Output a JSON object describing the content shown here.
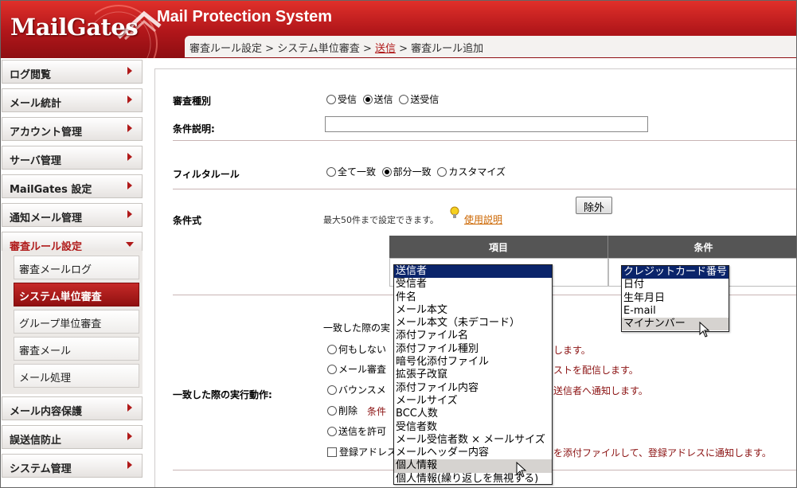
{
  "app": {
    "logo": "MailGates",
    "title": "Mail Protection System"
  },
  "breadcrumb": [
    "審査ルール設定",
    "システム単位審査",
    "送信",
    "審査ルール追加"
  ],
  "sidebar": {
    "items": [
      {
        "label": "ログ閲覧"
      },
      {
        "label": "メール統計"
      },
      {
        "label": "アカウント管理"
      },
      {
        "label": "サーバ管理"
      },
      {
        "label": "MailGates 設定"
      },
      {
        "label": "通知メール管理"
      },
      {
        "label": "審査ルール設定"
      },
      {
        "label": "メール内容保護"
      },
      {
        "label": "誤送信防止"
      },
      {
        "label": "システム管理"
      }
    ],
    "subitems": [
      {
        "label": "審査メールログ"
      },
      {
        "label": "システム単位審査"
      },
      {
        "label": "グループ単位審査"
      },
      {
        "label": "審査メール"
      },
      {
        "label": "メール処理"
      }
    ]
  },
  "form": {
    "type_label": "審査種別",
    "type_options": [
      "受信",
      "送信",
      "送受信"
    ],
    "type_selected": "送信",
    "desc_label": "条件説明:",
    "desc_value": "",
    "filter_label": "フィルタルール",
    "filter_options": [
      "全て一致",
      "部分一致",
      "カスタマイズ"
    ],
    "filter_selected": "部分一致",
    "condition_label": "条件式",
    "condition_note": "最大50件まで設定できます。",
    "help_link": "使用説明",
    "table_headers": [
      "項目",
      "条件"
    ],
    "exclude_button": "除外",
    "action_label": "一致した際の実行動作:",
    "action_intro": "一致した際の実",
    "actions": [
      {
        "left": "何もしない",
        "right": "します。"
      },
      {
        "left": "メール審査",
        "right": "ストを配信します。"
      },
      {
        "left": "バウンスメ",
        "right": "送信者へ通知します。"
      },
      {
        "left": "削除",
        "right_red": "条件",
        "right": ""
      },
      {
        "left": "送信を許可",
        "right": ""
      },
      {
        "left": "登録アドレス",
        "right": "を添付ファイルして、登録アドレスに通知します。"
      }
    ]
  },
  "item_list": {
    "options": [
      "送信者",
      "受信者",
      "件名",
      "メール本文",
      "メール本文（未デコード）",
      "添付ファイル名",
      "添付ファイル種別",
      "暗号化添付ファイル",
      "拡張子改竄",
      "添付ファイル内容",
      "メールサイズ",
      "BCC人数",
      "受信者数",
      "メール受信者数 × メールサイズ",
      "メールヘッダー内容",
      "個人情報",
      "個人情報(繰り返しを無視する)"
    ],
    "selected": "送信者",
    "hover": "個人情報"
  },
  "condition_list": {
    "options": [
      "クレジットカード番号",
      "日付",
      "生年月日",
      "E-mail",
      "マイナンバー"
    ],
    "selected": "クレジットカード番号",
    "hover": "マイナンバー"
  }
}
